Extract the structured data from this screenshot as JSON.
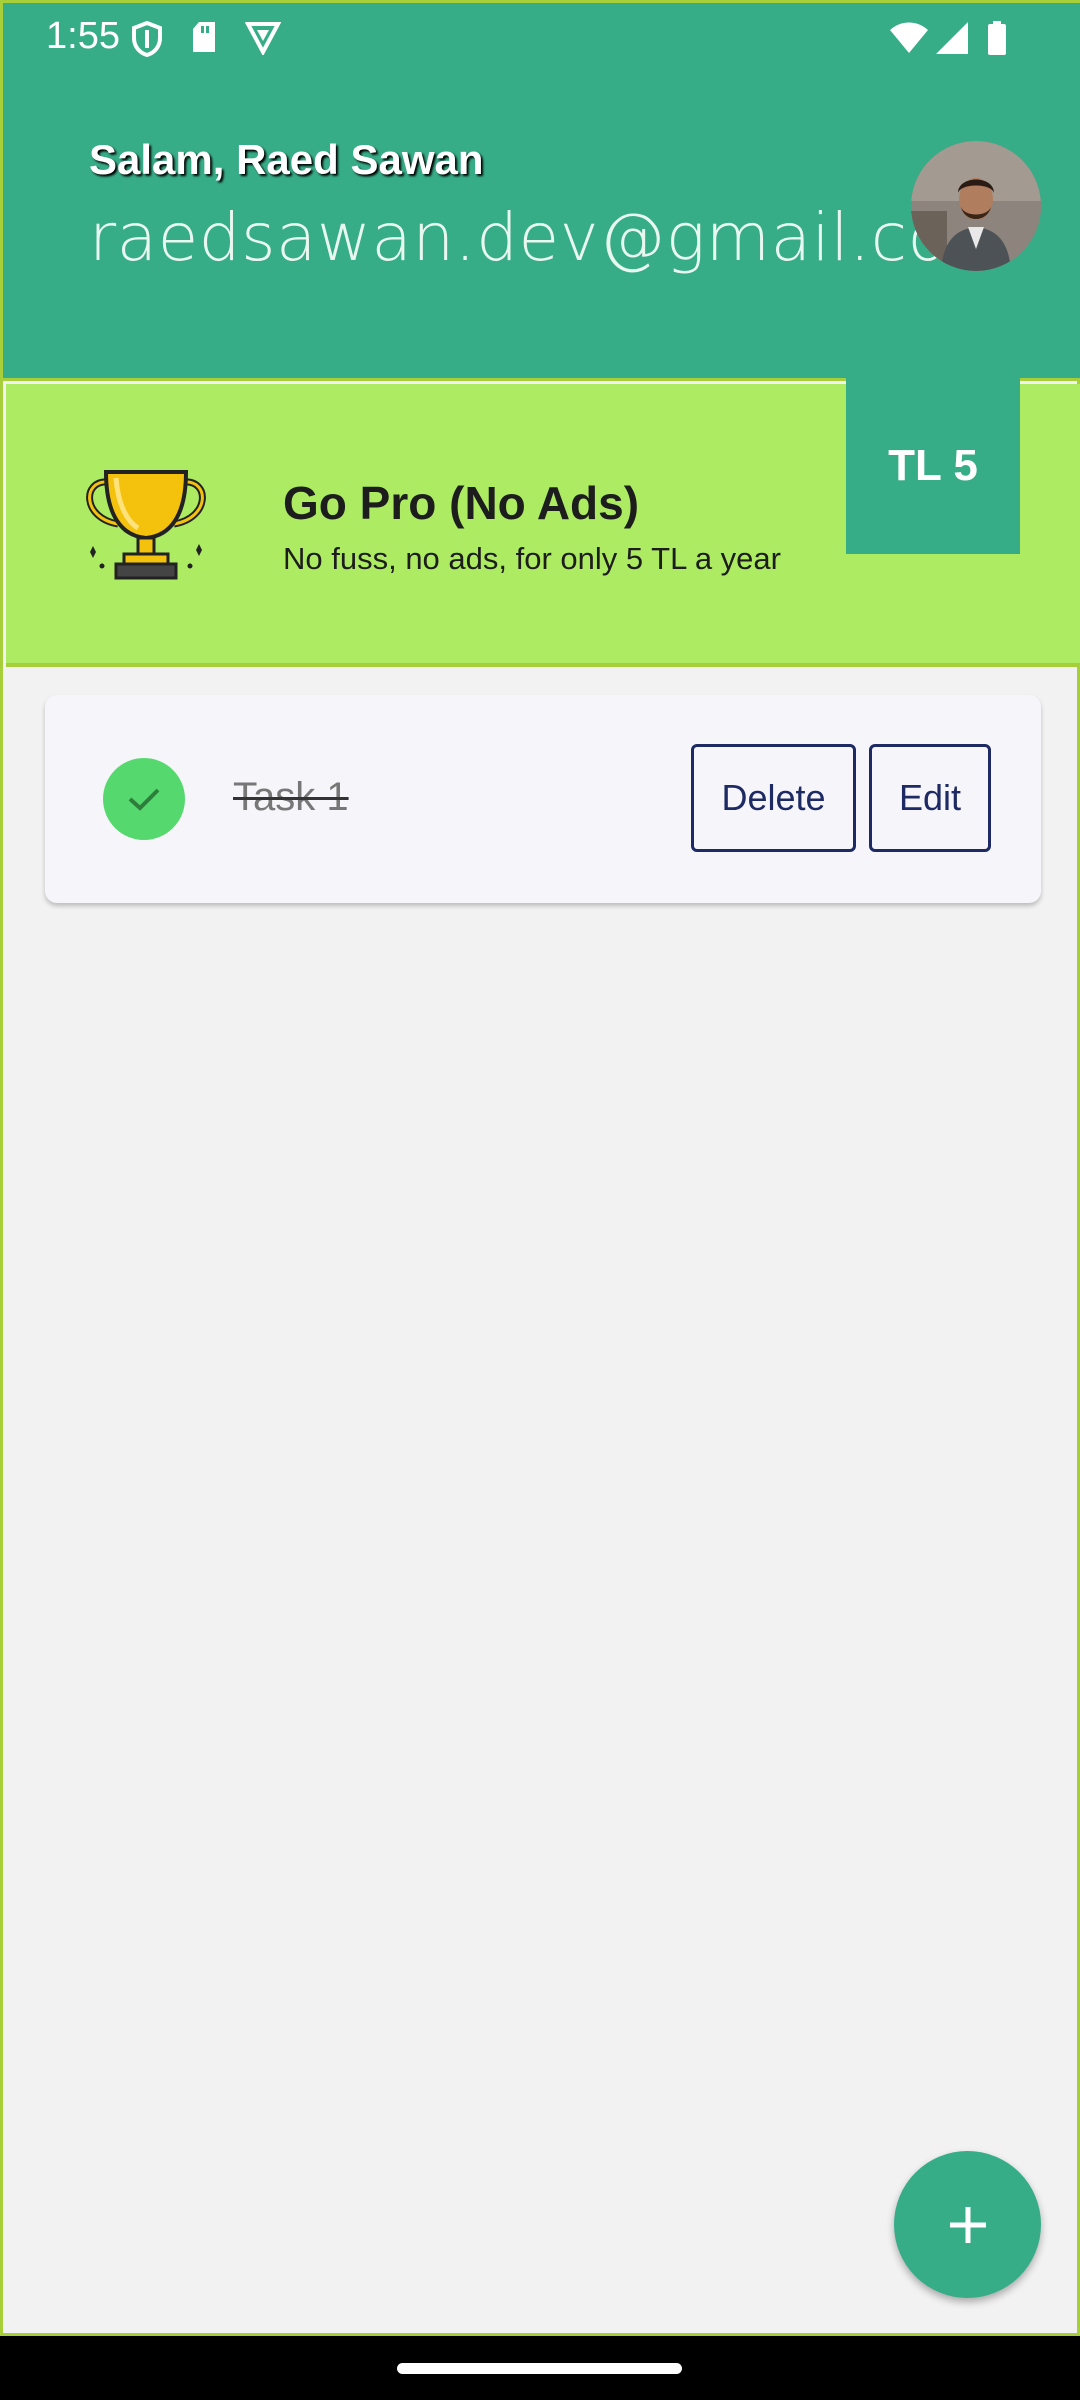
{
  "status_bar": {
    "time": "1:55",
    "left_icons": [
      "shield-icon",
      "sd-card-icon",
      "vpn-icon"
    ],
    "right_icons": [
      "wifi-icon",
      "signal-icon",
      "battery-icon"
    ]
  },
  "header": {
    "greeting": "Salam, Raed Sawan",
    "email": "raedsawan.dev@gmail.com",
    "accent_color": "#37ad87"
  },
  "promo": {
    "title": "Go Pro (No Ads)",
    "subtitle": "No fuss, no ads, for only 5 TL a year",
    "price": "TL 5",
    "background_color": "#adeb62",
    "icon": "trophy-icon"
  },
  "tasks": [
    {
      "title": "Task 1",
      "completed": true,
      "delete_label": "Delete",
      "edit_label": "Edit"
    }
  ],
  "fab": {
    "icon": "plus-icon"
  }
}
